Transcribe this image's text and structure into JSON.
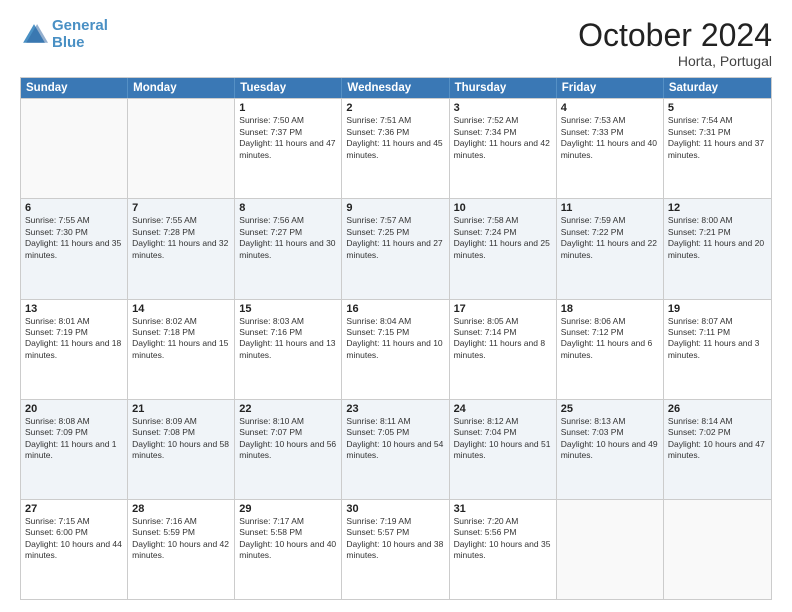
{
  "logo": {
    "line1": "General",
    "line2": "Blue"
  },
  "title": "October 2024",
  "location": "Horta, Portugal",
  "days_header": [
    "Sunday",
    "Monday",
    "Tuesday",
    "Wednesday",
    "Thursday",
    "Friday",
    "Saturday"
  ],
  "weeks": [
    [
      {
        "day": null
      },
      {
        "day": null
      },
      {
        "day": "1",
        "sunrise": "7:50 AM",
        "sunset": "7:37 PM",
        "daylight": "11 hours and 47 minutes."
      },
      {
        "day": "2",
        "sunrise": "7:51 AM",
        "sunset": "7:36 PM",
        "daylight": "11 hours and 45 minutes."
      },
      {
        "day": "3",
        "sunrise": "7:52 AM",
        "sunset": "7:34 PM",
        "daylight": "11 hours and 42 minutes."
      },
      {
        "day": "4",
        "sunrise": "7:53 AM",
        "sunset": "7:33 PM",
        "daylight": "11 hours and 40 minutes."
      },
      {
        "day": "5",
        "sunrise": "7:54 AM",
        "sunset": "7:31 PM",
        "daylight": "11 hours and 37 minutes."
      }
    ],
    [
      {
        "day": "6",
        "sunrise": "7:55 AM",
        "sunset": "7:30 PM",
        "daylight": "11 hours and 35 minutes."
      },
      {
        "day": "7",
        "sunrise": "7:55 AM",
        "sunset": "7:28 PM",
        "daylight": "11 hours and 32 minutes."
      },
      {
        "day": "8",
        "sunrise": "7:56 AM",
        "sunset": "7:27 PM",
        "daylight": "11 hours and 30 minutes."
      },
      {
        "day": "9",
        "sunrise": "7:57 AM",
        "sunset": "7:25 PM",
        "daylight": "11 hours and 27 minutes."
      },
      {
        "day": "10",
        "sunrise": "7:58 AM",
        "sunset": "7:24 PM",
        "daylight": "11 hours and 25 minutes."
      },
      {
        "day": "11",
        "sunrise": "7:59 AM",
        "sunset": "7:22 PM",
        "daylight": "11 hours and 22 minutes."
      },
      {
        "day": "12",
        "sunrise": "8:00 AM",
        "sunset": "7:21 PM",
        "daylight": "11 hours and 20 minutes."
      }
    ],
    [
      {
        "day": "13",
        "sunrise": "8:01 AM",
        "sunset": "7:19 PM",
        "daylight": "11 hours and 18 minutes."
      },
      {
        "day": "14",
        "sunrise": "8:02 AM",
        "sunset": "7:18 PM",
        "daylight": "11 hours and 15 minutes."
      },
      {
        "day": "15",
        "sunrise": "8:03 AM",
        "sunset": "7:16 PM",
        "daylight": "11 hours and 13 minutes."
      },
      {
        "day": "16",
        "sunrise": "8:04 AM",
        "sunset": "7:15 PM",
        "daylight": "11 hours and 10 minutes."
      },
      {
        "day": "17",
        "sunrise": "8:05 AM",
        "sunset": "7:14 PM",
        "daylight": "11 hours and 8 minutes."
      },
      {
        "day": "18",
        "sunrise": "8:06 AM",
        "sunset": "7:12 PM",
        "daylight": "11 hours and 6 minutes."
      },
      {
        "day": "19",
        "sunrise": "8:07 AM",
        "sunset": "7:11 PM",
        "daylight": "11 hours and 3 minutes."
      }
    ],
    [
      {
        "day": "20",
        "sunrise": "8:08 AM",
        "sunset": "7:09 PM",
        "daylight": "11 hours and 1 minute."
      },
      {
        "day": "21",
        "sunrise": "8:09 AM",
        "sunset": "7:08 PM",
        "daylight": "10 hours and 58 minutes."
      },
      {
        "day": "22",
        "sunrise": "8:10 AM",
        "sunset": "7:07 PM",
        "daylight": "10 hours and 56 minutes."
      },
      {
        "day": "23",
        "sunrise": "8:11 AM",
        "sunset": "7:05 PM",
        "daylight": "10 hours and 54 minutes."
      },
      {
        "day": "24",
        "sunrise": "8:12 AM",
        "sunset": "7:04 PM",
        "daylight": "10 hours and 51 minutes."
      },
      {
        "day": "25",
        "sunrise": "8:13 AM",
        "sunset": "7:03 PM",
        "daylight": "10 hours and 49 minutes."
      },
      {
        "day": "26",
        "sunrise": "8:14 AM",
        "sunset": "7:02 PM",
        "daylight": "10 hours and 47 minutes."
      }
    ],
    [
      {
        "day": "27",
        "sunrise": "7:15 AM",
        "sunset": "6:00 PM",
        "daylight": "10 hours and 44 minutes."
      },
      {
        "day": "28",
        "sunrise": "7:16 AM",
        "sunset": "5:59 PM",
        "daylight": "10 hours and 42 minutes."
      },
      {
        "day": "29",
        "sunrise": "7:17 AM",
        "sunset": "5:58 PM",
        "daylight": "10 hours and 40 minutes."
      },
      {
        "day": "30",
        "sunrise": "7:19 AM",
        "sunset": "5:57 PM",
        "daylight": "10 hours and 38 minutes."
      },
      {
        "day": "31",
        "sunrise": "7:20 AM",
        "sunset": "5:56 PM",
        "daylight": "10 hours and 35 minutes."
      },
      {
        "day": null
      },
      {
        "day": null
      }
    ]
  ]
}
